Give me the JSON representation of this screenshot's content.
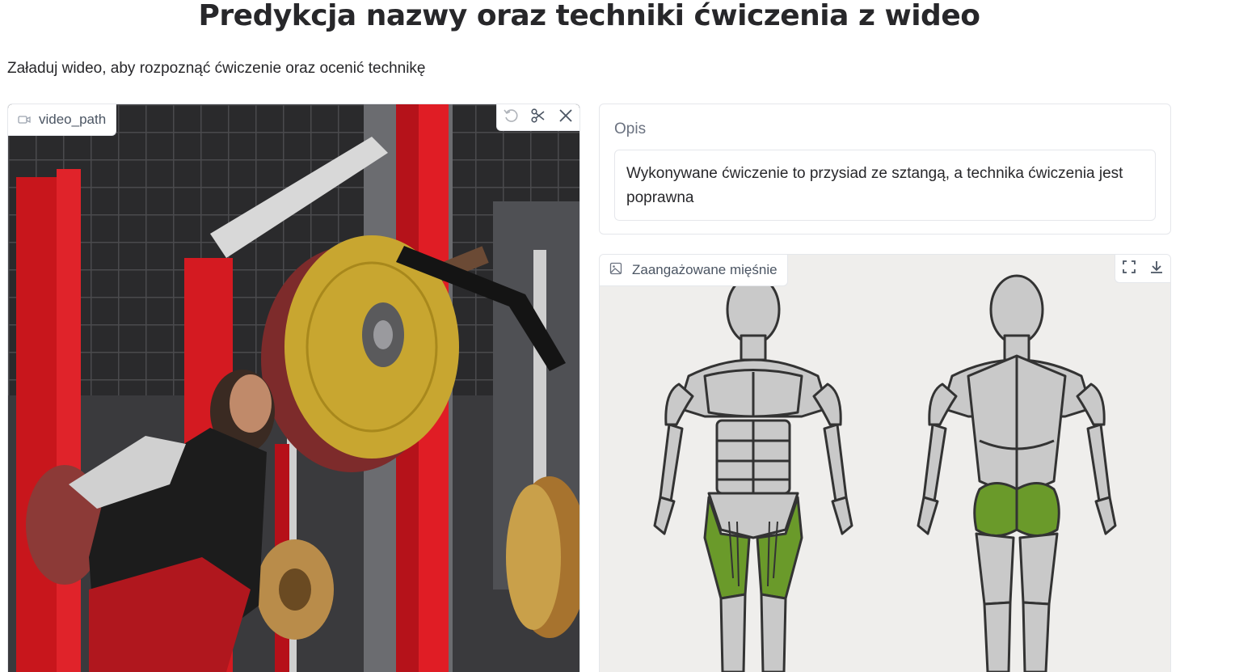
{
  "header": {
    "title": "Predykcja nazwy oraz techniki ćwiczenia z wideo",
    "description": "Załaduj wideo, aby rozpoznąć ćwiczenie oraz ocenić technikę"
  },
  "video": {
    "label": "video_path",
    "label_icon": "video-camera-icon",
    "controls": [
      "undo-icon",
      "scissors-icon",
      "close-icon"
    ]
  },
  "output": {
    "label": "Opis",
    "text": "Wykonywane ćwiczenie to przysiad ze sztangą, a technika ćwiczenia jest poprawna"
  },
  "muscles": {
    "label": "Zaangażowane mięśnie",
    "label_icon": "image-icon",
    "controls": [
      "fullscreen-icon",
      "download-icon"
    ],
    "highlight_color": "#6a9a2a"
  },
  "colors": {
    "border": "#e5e7eb",
    "title": "#27272a",
    "muted": "#6b7280",
    "muscle_base": "#c9c9c9",
    "muscle_outline": "#333333"
  }
}
